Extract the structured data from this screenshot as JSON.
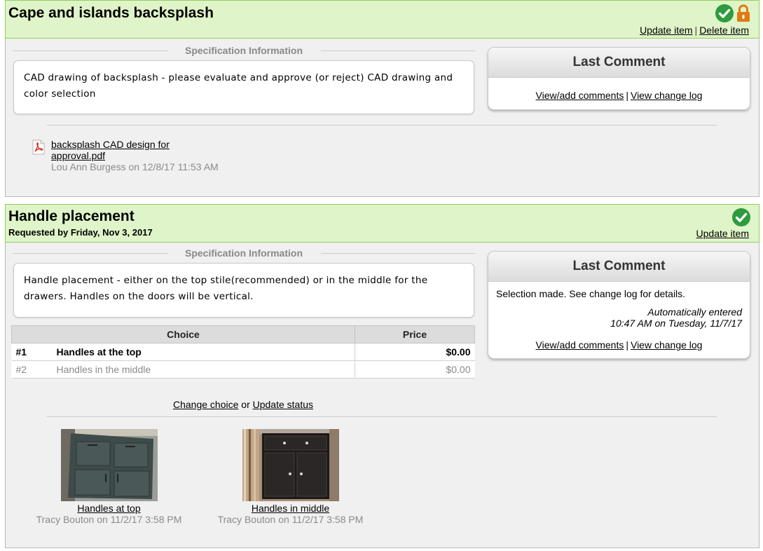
{
  "items": [
    {
      "title": "Cape and islands backsplash",
      "links": {
        "update": "Update item",
        "delete": "Delete item"
      },
      "spec_header": "Specification Information",
      "spec_text": "CAD drawing of backsplash - please evaluate and approve (or reject) CAD drawing and color selection",
      "comment": {
        "header": "Last Comment",
        "view_add": "View/add comments",
        "change_log": "View change log"
      },
      "attachment": {
        "filename": "backsplash CAD design for approval.pdf",
        "meta": "Lou Ann Burgess on 12/8/17 11:53 AM",
        "icon": "pdf-icon"
      },
      "status_icons": [
        "check-circle-icon",
        "lock-icon"
      ]
    },
    {
      "title": "Handle placement",
      "requested": "Requested by Friday, Nov 3, 2017",
      "links": {
        "update": "Update item"
      },
      "spec_header": "Specification Information",
      "spec_text": "Handle placement - either on the top stile(recommended) or in the middle for the drawers. Handles on the doors will be vertical.",
      "choices_table": {
        "headers": [
          "Choice",
          "Price"
        ],
        "rows": [
          {
            "num": "#1",
            "choice": "Handles at the top",
            "price": "$0.00",
            "selected": true
          },
          {
            "num": "#2",
            "choice": "Handles in the middle",
            "price": "$0.00",
            "selected": false
          }
        ]
      },
      "actions": {
        "change_choice": "Change choice",
        "or": "or",
        "update_status": "Update status"
      },
      "comment": {
        "header": "Last Comment",
        "text": "Selection made. See change log for details.",
        "auto_line1": "Automatically entered",
        "auto_line2": "10:47 AM on Tuesday, 11/7/17",
        "view_add": "View/add comments",
        "change_log": "View change log"
      },
      "images": [
        {
          "caption": "Handles at top",
          "meta": "Tracy Bouton on 11/2/17 3:58 PM"
        },
        {
          "caption": "Handles in middle",
          "meta": "Tracy Bouton on 11/2/17 3:58 PM"
        }
      ],
      "status_icons": [
        "check-circle-icon"
      ]
    }
  ],
  "colors": {
    "header_green": "#dff4c8",
    "check_green": "#2e9b3e",
    "lock_orange": "#e07a12"
  }
}
